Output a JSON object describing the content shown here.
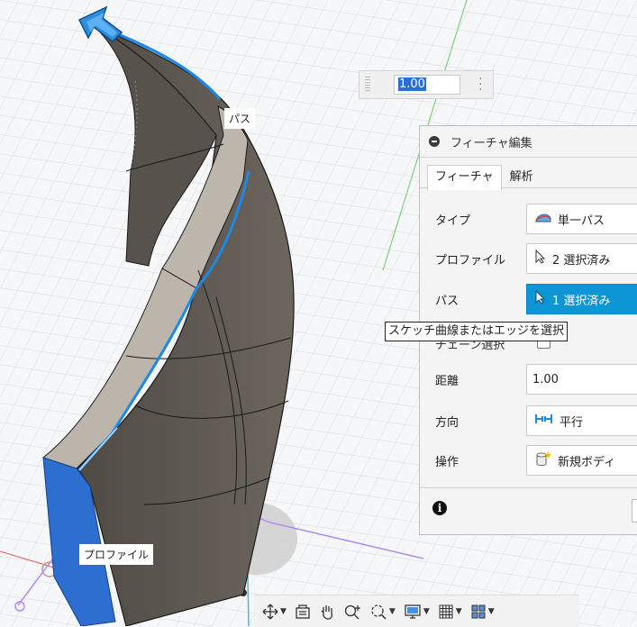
{
  "value_box": {
    "value": "1.00"
  },
  "panel": {
    "title": "フィーチャ編集",
    "tabs": [
      "フィーチャ",
      "解析"
    ],
    "rows": {
      "type": {
        "label": "タイプ",
        "value": "単一パス"
      },
      "profile": {
        "label": "プロファイル",
        "value": "2 選択済み"
      },
      "path": {
        "label": "パス",
        "value": "1 選択済み"
      },
      "chain": {
        "label": "チェーン選択"
      },
      "distance": {
        "label": "距離",
        "value": "1.00"
      },
      "direction": {
        "label": "方向",
        "value": "平行"
      },
      "operation": {
        "label": "操作",
        "value": "新規ボディ"
      }
    }
  },
  "tooltip": "スケッチ曲線またはエッジを選択",
  "viewport_labels": {
    "path": "パス",
    "profile": "プロファイル"
  },
  "colors": {
    "selection_blue": "#0d96d6",
    "edge_blue": "#1e88e5",
    "body_face": "#5f5a53",
    "profile_face": "#2d6fd1",
    "sketch_purple": "#b38cf0",
    "axis_red": "#e07a7a",
    "axis_green": "#7ed07e"
  },
  "toolbar": {
    "items": [
      "orbit-icon",
      "capture-position-icon",
      "pan-icon",
      "zoom-icon",
      "fit-icon",
      "display-settings-icon",
      "grid-icon",
      "viewports-icon"
    ]
  }
}
